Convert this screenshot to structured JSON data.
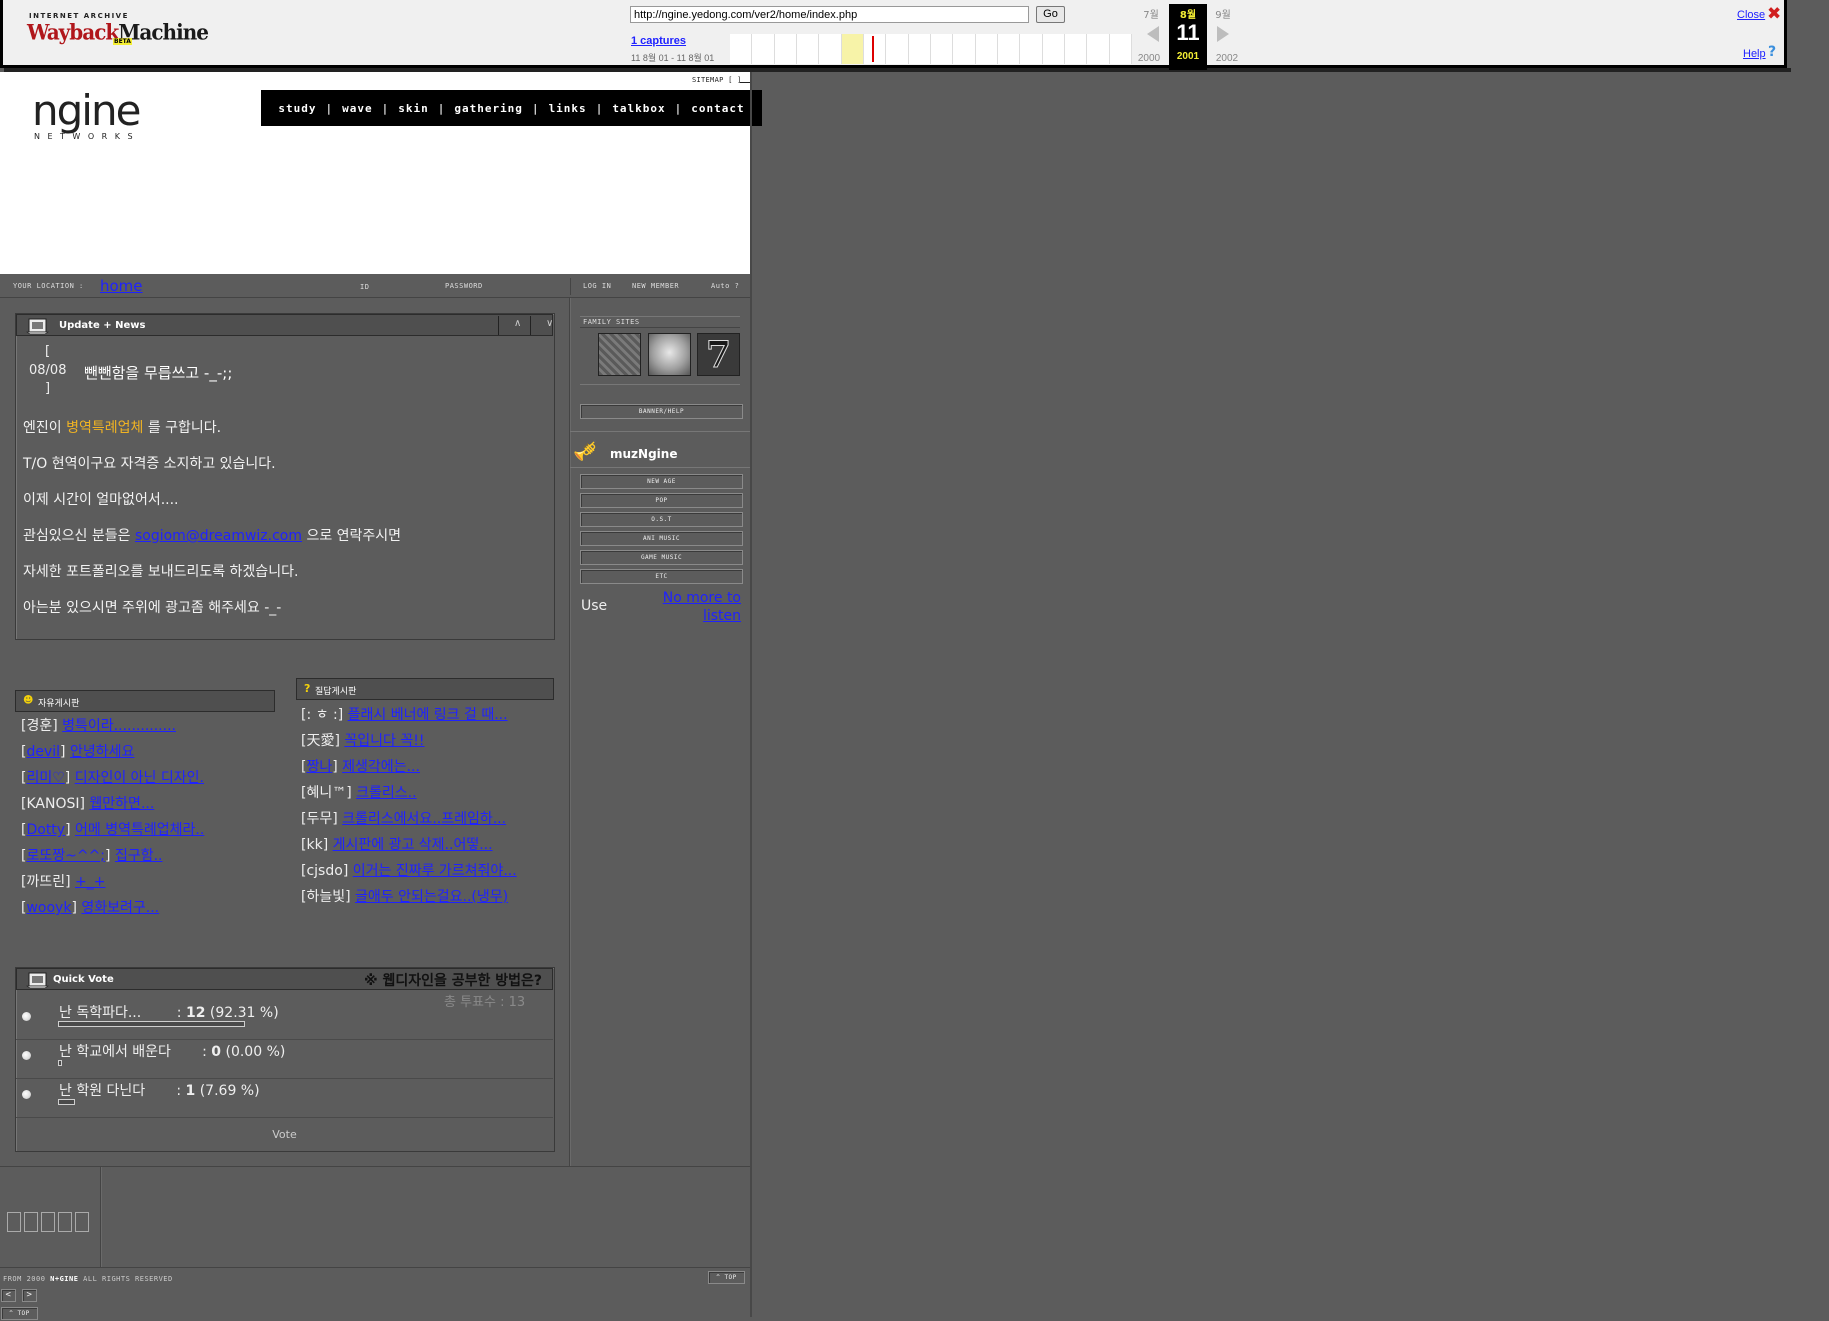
{
  "wayback": {
    "logo_top": "INTERNET ARCHIVE",
    "logo_a": "Wayback",
    "logo_b": "Machine",
    "beta": "BETA",
    "url": "http://ngine.yedong.com/ver2/home/index.php",
    "go": "Go",
    "captures": "1 captures",
    "range": "11 8월 01 - 11 8월 01",
    "prev_month": "7월",
    "cur_month": "8월",
    "cur_day": "11",
    "next_month": "9월",
    "prev_year": "2000",
    "cur_year": "2001",
    "next_year": "2002",
    "close": "Close",
    "close_icon": "✖",
    "help": "Help",
    "help_icon": "?"
  },
  "site": {
    "logo": "ngine",
    "logo_sub": "NETWORKS",
    "sitemap": "SITEMAP [ ]",
    "nav": [
      "study",
      "wave",
      "skin",
      "gathering",
      "links",
      "talkbox",
      "contact"
    ],
    "nav_sep": "|"
  },
  "locbar": {
    "your_location": "YOUR LOCATION :",
    "home": "home",
    "id_label": "ID",
    "password_label": "PASSWORD",
    "login": "LOG IN",
    "new_member": "NEW MEMBER",
    "auto": "Auto ?"
  },
  "news": {
    "title": "Update + News",
    "up": "∧",
    "down": "∨",
    "bracket_open": "[",
    "date": "08/08",
    "bracket_close": "]",
    "headline": "뺀뺀함을 무릅쓰고 -_-;;",
    "line1_a": "엔진이 ",
    "line1_b": "병역특례업체",
    "line1_c": " 를 구합니다.",
    "line2": "T/O 현역이구요 자격증 소지하고 있습니다.",
    "line3": "이제 시간이 얼마없어서....",
    "line4_a": "관심있으신 분들은 ",
    "line4_link": "sogiom@dreamwiz.com",
    "line4_c": " 으로 연락주시면",
    "line5": "자세한 포트폴리오를 보내드리도록 하겠습니다.",
    "line6": "아는분 있으시면 주위에 광고좀 해주세요 -_-"
  },
  "free_board": {
    "title": "자유게시판",
    "items": [
      {
        "author": "경훈",
        "author_link": false,
        "title": "병특이라.............."
      },
      {
        "author": "devil",
        "author_link": true,
        "title": "안녕하세요"
      },
      {
        "author": "리미♡",
        "author_link": true,
        "title": "디자인이 아닌 디자인."
      },
      {
        "author": "KANOSI",
        "author_link": false,
        "title": "웹만하면..."
      },
      {
        "author": "Dotty",
        "author_link": true,
        "title": "어메 병역특례업체라.."
      },
      {
        "author": "로또짱~^^;",
        "author_link": true,
        "title": "집구함.."
      },
      {
        "author": "까뜨린",
        "author_link": false,
        "title": "+_+"
      },
      {
        "author": "wooyk",
        "author_link": true,
        "title": "영화보려구..."
      }
    ]
  },
  "qa_board": {
    "title": "질답게시판",
    "items": [
      {
        "author": ": ㅎ :",
        "author_link": false,
        "title": "플래시 베너에 링크 걸 때..."
      },
      {
        "author": "天愛",
        "author_link": false,
        "title": "꼭입니다 꼭!!"
      },
      {
        "author": "짱나",
        "author_link": true,
        "title": "제생각에는..."
      },
      {
        "author": "혜니™",
        "author_link": false,
        "title": "크롤리스.."
      },
      {
        "author": "두무",
        "author_link": false,
        "title": "크롤리스에서요..프레임하..."
      },
      {
        "author": "kk",
        "author_link": false,
        "title": "게시판에 광고 삭제..어떻..."
      },
      {
        "author": "cjsdo",
        "author_link": false,
        "title": "이거는 진짜루 가르쳐줘야..."
      },
      {
        "author": "하늘빛",
        "author_link": false,
        "title": "글애두 안되는걸요..(냉무)"
      }
    ]
  },
  "vote": {
    "title": "Quick Vote",
    "question": "※ 웹디자인을 공부한 방법은?",
    "total": "총 투표수 : 13",
    "options": [
      {
        "label": "난 독학파다...",
        "count": "12",
        "pct": "(92.31 %)",
        "fraction": 0.9231
      },
      {
        "label": "난 학교에서 배운다",
        "count": "0",
        "pct": "(0.00 %)",
        "fraction": 0.0
      },
      {
        "label": "난 학원 다닌다",
        "count": "1",
        "pct": "(7.69 %)",
        "fraction": 0.0769
      }
    ],
    "button": "Vote"
  },
  "sidebar": {
    "family_sites": "FAMILY SITES",
    "banner_help": "BANNER/HELP",
    "muz_title": "muzNgine",
    "genres": [
      "NEW AGE",
      "POP",
      "O.S.T",
      "ANI MUSIC",
      "GAME MUSIC",
      "ETC"
    ],
    "use": "Use",
    "no_more": "No more to listen"
  },
  "footer": {
    "copyright_a": "FROM 2000 ",
    "copyright_b": "N+GINE",
    "copyright_c": " ALL RIGHTS RESERVED",
    "top": "^ TOP",
    "prev": "<",
    "next": ">",
    "top2": "^ TOP"
  }
}
